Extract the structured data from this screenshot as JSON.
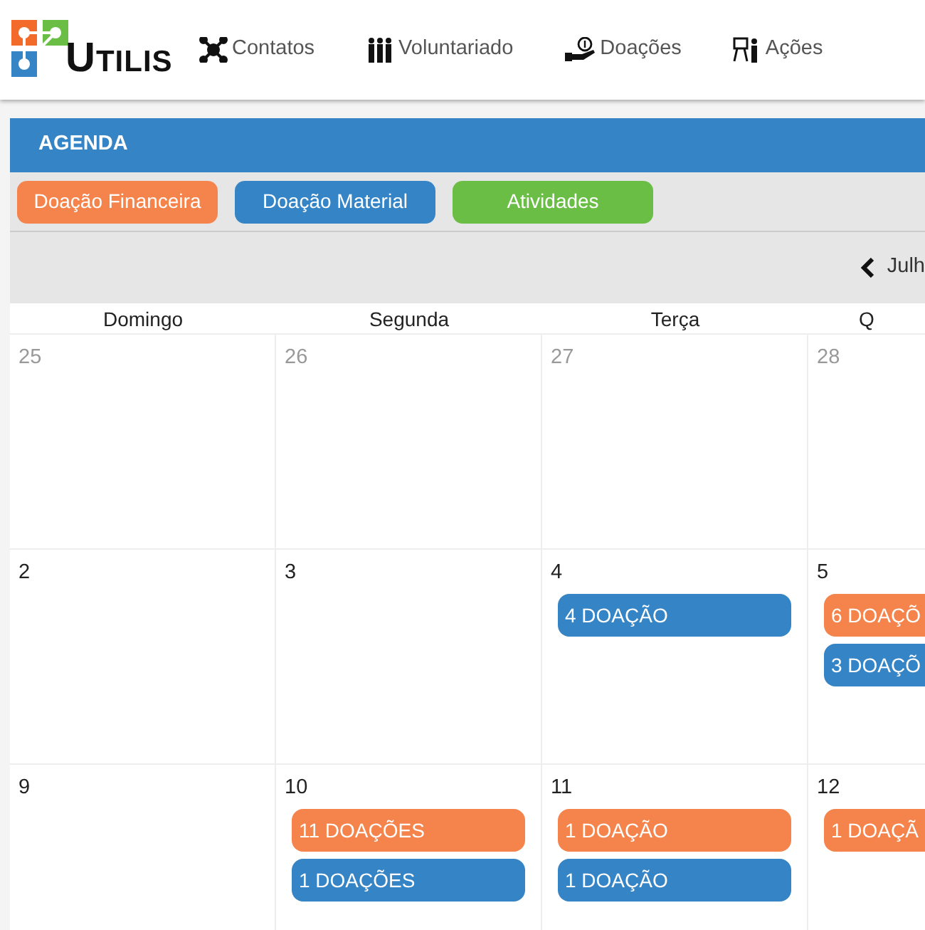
{
  "brand": {
    "name": "UTILIS"
  },
  "nav": [
    {
      "label": "Contatos"
    },
    {
      "label": "Voluntariado"
    },
    {
      "label": "Doações"
    },
    {
      "label": "Ações"
    }
  ],
  "panel": {
    "title": "AGENDA"
  },
  "legend": [
    {
      "label": "Doação Financeira",
      "color": "#f5844c"
    },
    {
      "label": "Doação Material",
      "color": "#3584c6"
    },
    {
      "label": "Atividades",
      "color": "#6abd45"
    }
  ],
  "month_nav": {
    "label": "Julh"
  },
  "weekdays": [
    "Domingo",
    "Segunda",
    "Terça",
    "Q"
  ],
  "weeks": [
    {
      "days": [
        {
          "day": "25",
          "other_month": true
        },
        {
          "day": "26",
          "other_month": true
        },
        {
          "day": "27",
          "other_month": true
        },
        {
          "day": "28",
          "other_month": true
        }
      ]
    },
    {
      "days": [
        {
          "day": "2",
          "other_month": false
        },
        {
          "day": "3",
          "other_month": false
        },
        {
          "day": "4",
          "other_month": false,
          "events": [
            {
              "label": "4 DOAÇÃO",
              "color": "#3584c6"
            }
          ]
        },
        {
          "day": "5",
          "other_month": false,
          "events": [
            {
              "label": "6 DOAÇÕ",
              "color": "#f5844c"
            },
            {
              "label": "3 DOAÇÕ",
              "color": "#3584c6"
            }
          ]
        }
      ]
    },
    {
      "days": [
        {
          "day": "9",
          "other_month": false
        },
        {
          "day": "10",
          "other_month": false,
          "events": [
            {
              "label": "11 DOAÇÕES",
              "color": "#f5844c"
            },
            {
              "label": "1 DOAÇÕES",
              "color": "#3584c6"
            }
          ]
        },
        {
          "day": "11",
          "other_month": false,
          "events": [
            {
              "label": "1 DOAÇÃO",
              "color": "#f5844c"
            },
            {
              "label": "1 DOAÇÃO",
              "color": "#3584c6"
            }
          ]
        },
        {
          "day": "12",
          "other_month": false,
          "events": [
            {
              "label": "1 DOAÇÃ",
              "color": "#f5844c"
            }
          ]
        }
      ]
    }
  ]
}
